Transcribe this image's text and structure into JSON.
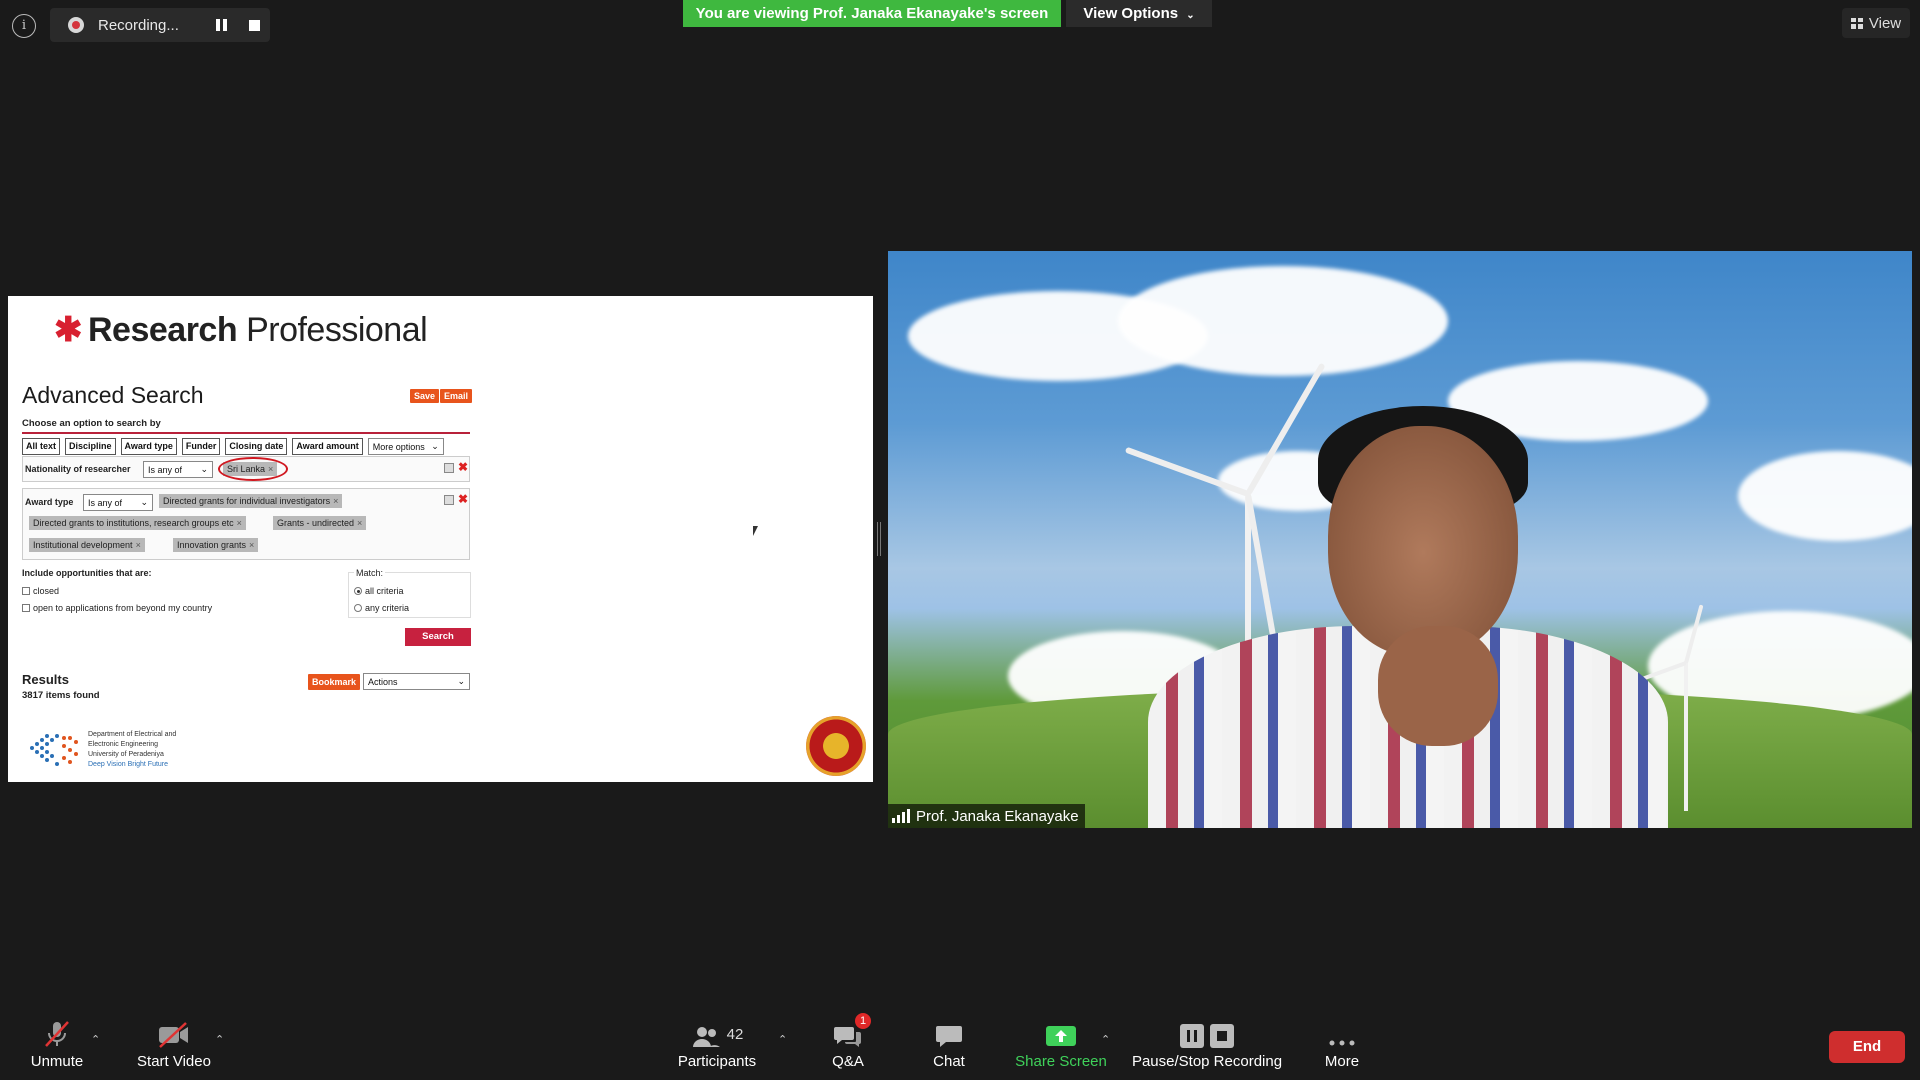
{
  "top": {
    "recording_label": "Recording...",
    "banner": "You are viewing Prof. Janaka Ekanayake's screen",
    "view_options": "View Options",
    "view": "View"
  },
  "shared": {
    "brand_bold": "Research",
    "brand_light": "Professional",
    "title": "Advanced Search",
    "save": "Save",
    "email": "Email",
    "choose": "Choose an option to search by",
    "options": [
      "All text",
      "Discipline",
      "Award type",
      "Funder",
      "Closing date",
      "Award amount"
    ],
    "more_options": "More options",
    "nationality": {
      "label": "Nationality of researcher",
      "operator": "Is any of",
      "tags": [
        "Sri Lanka"
      ]
    },
    "award": {
      "label": "Award type",
      "operator": "Is any of",
      "tags": [
        "Directed grants for individual investigators",
        "Directed grants to institutions, research groups etc",
        "Grants - undirected",
        "Institutional development",
        "Innovation grants"
      ]
    },
    "include_title": "Include opportunities that are:",
    "include_opts": [
      "closed",
      "open to applications from beyond my country"
    ],
    "match_title": "Match:",
    "match_opts": [
      "all criteria",
      "any criteria"
    ],
    "search": "Search",
    "results_title": "Results",
    "results_count": "3817 items found",
    "bookmark": "Bookmark",
    "actions": "Actions",
    "dept": [
      "Department of Electrical and",
      "Electronic Engineering",
      "University of Peradeniya",
      "Deep Vision Bright Future"
    ]
  },
  "video": {
    "participant_name": "Prof. Janaka Ekanayake"
  },
  "toolbar": {
    "unmute": "Unmute",
    "start_video": "Start Video",
    "participants": "Participants",
    "participants_count": "42",
    "qa": "Q&A",
    "qa_badge": "1",
    "chat": "Chat",
    "share": "Share Screen",
    "pause_stop": "Pause/Stop Recording",
    "more": "More",
    "end": "End",
    "share_color": "#3fd15a",
    "end_color": "#cf2e2e"
  }
}
